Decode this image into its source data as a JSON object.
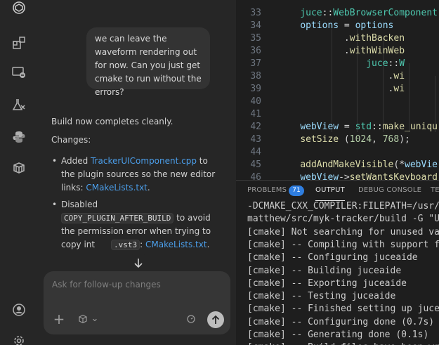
{
  "activity_bar": {
    "icons": [
      "openai-logo-icon",
      "extensions-icon",
      "remote-explorer-icon",
      "testing-flask-icon",
      "python-icon",
      "package-icon",
      "account-icon",
      "settings-gear-icon"
    ]
  },
  "chat": {
    "user_message": "we can leave the waveform rendering out for now. Can you just get cmake to run without the errors?",
    "response_intro": "Build now completes cleanly.",
    "changes_label": "Changes:",
    "bullet1": {
      "pre": "Added ",
      "link": "TrackerUIComponent.cpp",
      "mid": " to the plugin sources so the new editor links: ",
      "link2": "CMakeLists.txt",
      "post": "."
    },
    "bullet2": {
      "pre": "Disabled",
      "code": "COPY_PLUGIN_AFTER_BUILD",
      "mid": " to avoid the permission error when trying to copy int",
      "code2": ".vst3",
      "post": ":",
      "link": "CMakeLists.txt",
      "tail": "."
    },
    "composer": {
      "placeholder": "Ask for follow-up changes",
      "plus": "+",
      "model_chevron": "⌄"
    }
  },
  "editor": {
    "lines": [
      {
        "n": "33",
        "t": "    juce::WebBrowserComponent"
      },
      {
        "n": "34",
        "t": "    options = options"
      },
      {
        "n": "35",
        "t": "            .withBacken"
      },
      {
        "n": "36",
        "t": "            .withWinWeb"
      },
      {
        "n": "37",
        "t": "                juce::W"
      },
      {
        "n": "38",
        "t": "                    .wi"
      },
      {
        "n": "39",
        "t": "                    .wi"
      },
      {
        "n": "40",
        "t": ""
      },
      {
        "n": "41",
        "t": ""
      },
      {
        "n": "42",
        "t": "    webView = std::make_uniqu"
      },
      {
        "n": "43",
        "t": "    setSize (1024, 768);"
      },
      {
        "n": "44",
        "t": ""
      },
      {
        "n": "45",
        "t": "    addAndMakeVisible(*webVie"
      },
      {
        "n": "46",
        "t": "    webView->setWantsKeyboard"
      }
    ]
  },
  "panel": {
    "tabs": [
      {
        "label": "PROBLEMS",
        "badge": "71"
      },
      {
        "label": "OUTPUT",
        "active": true
      },
      {
        "label": "DEBUG CONSOLE"
      },
      {
        "label": "TE"
      }
    ],
    "output_lines": [
      "-DCMAKE_CXX_COMPILER:FILEPATH=/usr/",
      "matthew/src/myk-tracker/build -G \"U",
      "[cmake] Not searching for unused va",
      "[cmake] -- Compiling with support f",
      "[cmake] -- Configuring juceaide",
      "[cmake] -- Building juceaide",
      "[cmake] -- Exporting juceaide",
      "[cmake] -- Testing juceaide",
      "[cmake] -- Finished setting up juce",
      "[cmake] -- Configuring done (0.7s)",
      "[cmake] -- Generating done (0.1s)",
      "[cmake] -- Build files have been wr"
    ]
  },
  "colors": {
    "accent": "#4b9eea",
    "badge": "#2f7ee0",
    "editor_bg": "#1e1e1e",
    "sidebar_bg": "#262626"
  }
}
